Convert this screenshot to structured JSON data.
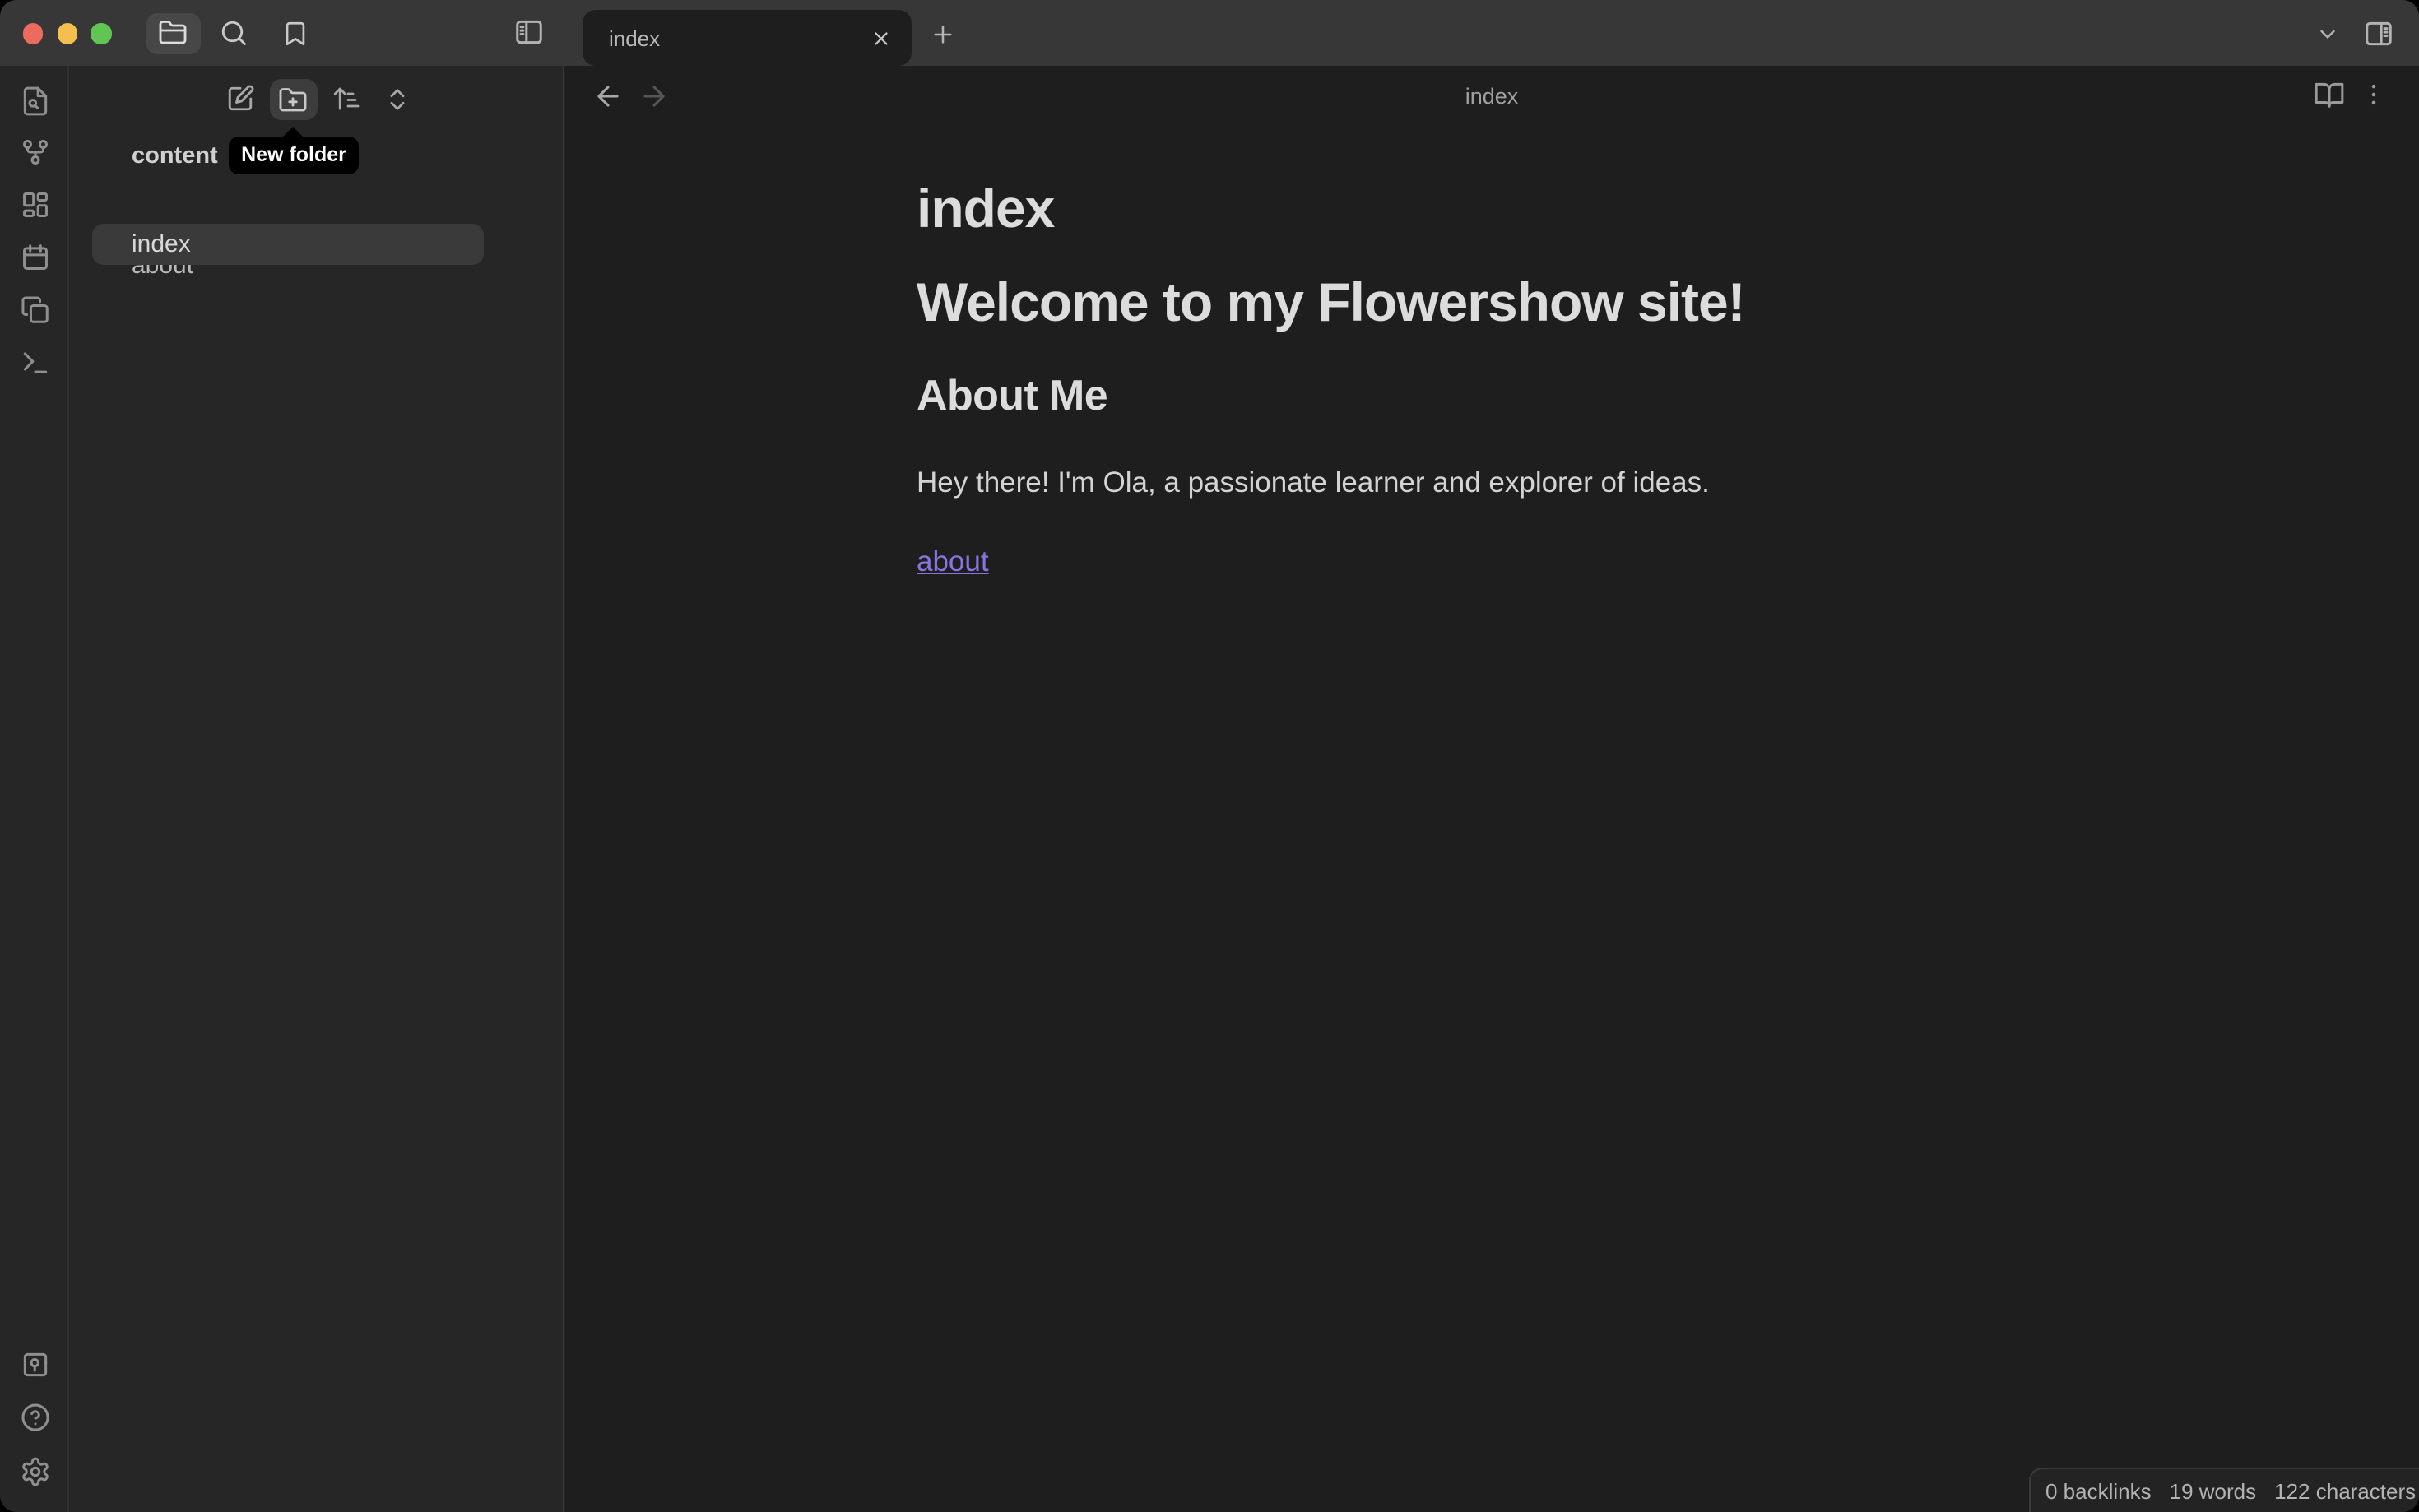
{
  "window": {
    "app": "Obsidian",
    "traffic_lights": [
      "close",
      "minimize",
      "zoom"
    ],
    "titlebar_icons": [
      "folder-icon",
      "search-icon",
      "bookmark-icon",
      "panel-left-icon",
      "chevron-down-icon",
      "panel-right-icon"
    ]
  },
  "tabbar": {
    "active_tab": "index",
    "close_label": "close-tab",
    "new_tab": "+"
  },
  "ribbon": {
    "top_icons": [
      "file-search-icon",
      "git-fork-icon",
      "layout-dashboard-icon",
      "calendar-icon",
      "copy-icon",
      "terminal-icon"
    ],
    "bottom_icons": [
      "vault-icon",
      "help-icon",
      "settings-gear-icon"
    ]
  },
  "explorer": {
    "toolbar_icons": [
      "new-note-icon",
      "new-folder-icon",
      "sort-icon",
      "chevrons-up-down-icon"
    ],
    "tooltip": "New folder",
    "vault_name": "content",
    "files": [
      {
        "name": "about",
        "selected": false
      },
      {
        "name": "index",
        "selected": true
      }
    ]
  },
  "editor": {
    "breadcrumb": "index",
    "header_icons": [
      "arrow-left-icon",
      "arrow-right-icon",
      "book-open-icon",
      "more-vertical-icon"
    ],
    "content": {
      "title": "index",
      "heading": "Welcome to my Flowershow site!",
      "subheading": "About Me",
      "paragraph": "Hey there! I'm Ola, a passionate learner and explorer of ideas.",
      "link": "about"
    },
    "status": {
      "backlinks": "0 backlinks",
      "words": "19 words",
      "characters": "122 characters"
    }
  },
  "colors": {
    "titlebar_bg": "#373737",
    "sidebar_bg": "#262626",
    "editor_bg": "#1e1e1e",
    "selection_bg": "#3a3a3a",
    "tooltip_bg": "#000000",
    "link_accent": "#8a74dd",
    "traffic_red": "#ec6a5e",
    "traffic_yellow": "#f5bf4f",
    "traffic_green": "#61c554"
  }
}
